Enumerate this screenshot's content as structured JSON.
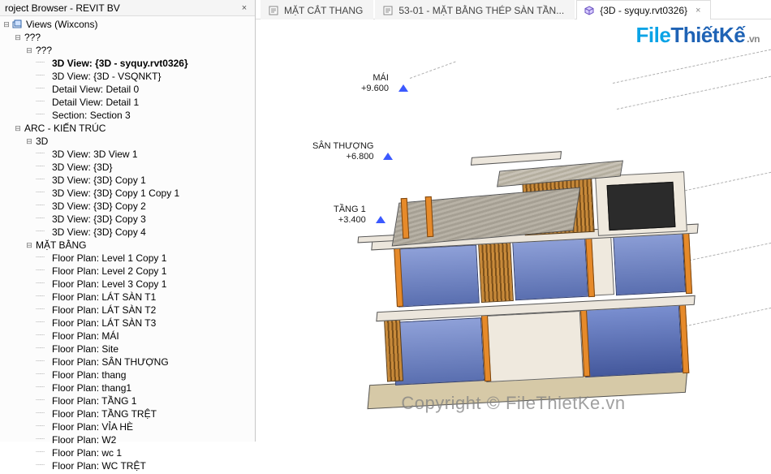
{
  "panel": {
    "title": "roject Browser - REVIT BV",
    "close": "×"
  },
  "tree": {
    "views_root": "Views (Wixcons)",
    "q1": "???",
    "q2": "???",
    "active_view": "3D View: {3D - syquy.rvt0326}",
    "items_top": [
      "3D View: {3D - VSQNKT}",
      "Detail View: Detail 0",
      "Detail View: Detail 1",
      "Section: Section 3"
    ],
    "arc_label": "ARC - KIẾN TRÚC",
    "grp_3d": "3D",
    "items_3d": [
      "3D View: 3D View 1",
      "3D View: {3D}",
      "3D View: {3D} Copy 1",
      "3D View: {3D} Copy 1 Copy 1",
      "3D View: {3D} Copy 2",
      "3D View: {3D} Copy 3",
      "3D View: {3D} Copy 4"
    ],
    "grp_mb": "MẶT BẰNG",
    "items_mb": [
      "Floor Plan: Level 1 Copy 1",
      "Floor Plan: Level 2 Copy 1",
      "Floor Plan: Level 3 Copy 1",
      "Floor Plan: LÁT SÀN T1",
      "Floor Plan: LÁT SÀN T2",
      "Floor Plan: LÁT SÀN T3",
      "Floor Plan: MÁI",
      "Floor Plan: Site",
      "Floor Plan: SÂN THƯỢNG",
      "Floor Plan: thang",
      "Floor Plan: thang1",
      "Floor Plan: TẦNG 1",
      "Floor Plan: TẦNG TRỆT",
      "Floor Plan: VỈA HÈ",
      "Floor Plan: W2",
      "Floor Plan: wc 1",
      "Floor Plan: WC TRỆT"
    ]
  },
  "tabs": {
    "t1": "MẶT CẮT THANG",
    "t2": "53-01 - MẶT BẰNG THÉP SÀN TẦN...",
    "t3": "{3D - syquy.rvt0326}"
  },
  "levels": {
    "mai": {
      "name": "MÁI",
      "elev": "+9.600"
    },
    "san": {
      "name": "SÂN THƯỢNG",
      "elev": "+6.800"
    },
    "t1": {
      "name": "TẦNG 1",
      "elev": "+3.400"
    }
  },
  "watermark": {
    "logo_a": "File",
    "logo_b": "ThiếtKế",
    "logo_vn": ".vn",
    "center": "Copyright © FileThietKe.vn"
  }
}
